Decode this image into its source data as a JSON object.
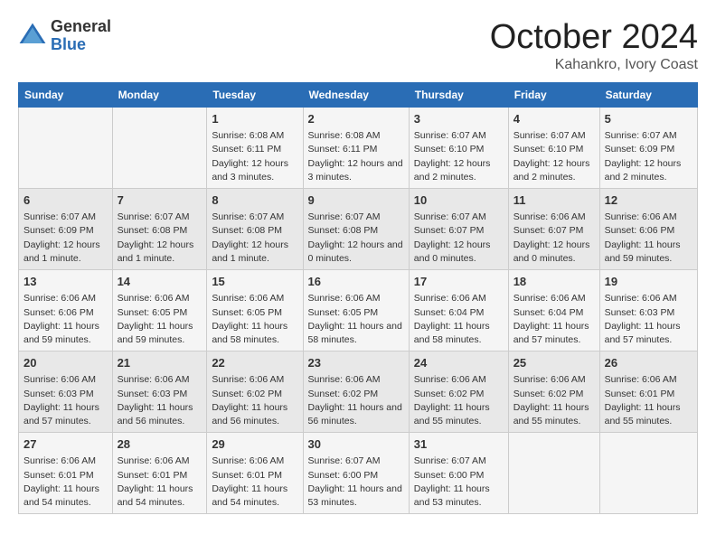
{
  "header": {
    "logo_general": "General",
    "logo_blue": "Blue",
    "month": "October 2024",
    "location": "Kahankro, Ivory Coast"
  },
  "days_of_week": [
    "Sunday",
    "Monday",
    "Tuesday",
    "Wednesday",
    "Thursday",
    "Friday",
    "Saturday"
  ],
  "weeks": [
    [
      {
        "day": "",
        "info": ""
      },
      {
        "day": "",
        "info": ""
      },
      {
        "day": "1",
        "info": "Sunrise: 6:08 AM\nSunset: 6:11 PM\nDaylight: 12 hours and 3 minutes."
      },
      {
        "day": "2",
        "info": "Sunrise: 6:08 AM\nSunset: 6:11 PM\nDaylight: 12 hours and 3 minutes."
      },
      {
        "day": "3",
        "info": "Sunrise: 6:07 AM\nSunset: 6:10 PM\nDaylight: 12 hours and 2 minutes."
      },
      {
        "day": "4",
        "info": "Sunrise: 6:07 AM\nSunset: 6:10 PM\nDaylight: 12 hours and 2 minutes."
      },
      {
        "day": "5",
        "info": "Sunrise: 6:07 AM\nSunset: 6:09 PM\nDaylight: 12 hours and 2 minutes."
      }
    ],
    [
      {
        "day": "6",
        "info": "Sunrise: 6:07 AM\nSunset: 6:09 PM\nDaylight: 12 hours and 1 minute."
      },
      {
        "day": "7",
        "info": "Sunrise: 6:07 AM\nSunset: 6:08 PM\nDaylight: 12 hours and 1 minute."
      },
      {
        "day": "8",
        "info": "Sunrise: 6:07 AM\nSunset: 6:08 PM\nDaylight: 12 hours and 1 minute."
      },
      {
        "day": "9",
        "info": "Sunrise: 6:07 AM\nSunset: 6:08 PM\nDaylight: 12 hours and 0 minutes."
      },
      {
        "day": "10",
        "info": "Sunrise: 6:07 AM\nSunset: 6:07 PM\nDaylight: 12 hours and 0 minutes."
      },
      {
        "day": "11",
        "info": "Sunrise: 6:06 AM\nSunset: 6:07 PM\nDaylight: 12 hours and 0 minutes."
      },
      {
        "day": "12",
        "info": "Sunrise: 6:06 AM\nSunset: 6:06 PM\nDaylight: 11 hours and 59 minutes."
      }
    ],
    [
      {
        "day": "13",
        "info": "Sunrise: 6:06 AM\nSunset: 6:06 PM\nDaylight: 11 hours and 59 minutes."
      },
      {
        "day": "14",
        "info": "Sunrise: 6:06 AM\nSunset: 6:05 PM\nDaylight: 11 hours and 59 minutes."
      },
      {
        "day": "15",
        "info": "Sunrise: 6:06 AM\nSunset: 6:05 PM\nDaylight: 11 hours and 58 minutes."
      },
      {
        "day": "16",
        "info": "Sunrise: 6:06 AM\nSunset: 6:05 PM\nDaylight: 11 hours and 58 minutes."
      },
      {
        "day": "17",
        "info": "Sunrise: 6:06 AM\nSunset: 6:04 PM\nDaylight: 11 hours and 58 minutes."
      },
      {
        "day": "18",
        "info": "Sunrise: 6:06 AM\nSunset: 6:04 PM\nDaylight: 11 hours and 57 minutes."
      },
      {
        "day": "19",
        "info": "Sunrise: 6:06 AM\nSunset: 6:03 PM\nDaylight: 11 hours and 57 minutes."
      }
    ],
    [
      {
        "day": "20",
        "info": "Sunrise: 6:06 AM\nSunset: 6:03 PM\nDaylight: 11 hours and 57 minutes."
      },
      {
        "day": "21",
        "info": "Sunrise: 6:06 AM\nSunset: 6:03 PM\nDaylight: 11 hours and 56 minutes."
      },
      {
        "day": "22",
        "info": "Sunrise: 6:06 AM\nSunset: 6:02 PM\nDaylight: 11 hours and 56 minutes."
      },
      {
        "day": "23",
        "info": "Sunrise: 6:06 AM\nSunset: 6:02 PM\nDaylight: 11 hours and 56 minutes."
      },
      {
        "day": "24",
        "info": "Sunrise: 6:06 AM\nSunset: 6:02 PM\nDaylight: 11 hours and 55 minutes."
      },
      {
        "day": "25",
        "info": "Sunrise: 6:06 AM\nSunset: 6:02 PM\nDaylight: 11 hours and 55 minutes."
      },
      {
        "day": "26",
        "info": "Sunrise: 6:06 AM\nSunset: 6:01 PM\nDaylight: 11 hours and 55 minutes."
      }
    ],
    [
      {
        "day": "27",
        "info": "Sunrise: 6:06 AM\nSunset: 6:01 PM\nDaylight: 11 hours and 54 minutes."
      },
      {
        "day": "28",
        "info": "Sunrise: 6:06 AM\nSunset: 6:01 PM\nDaylight: 11 hours and 54 minutes."
      },
      {
        "day": "29",
        "info": "Sunrise: 6:06 AM\nSunset: 6:01 PM\nDaylight: 11 hours and 54 minutes."
      },
      {
        "day": "30",
        "info": "Sunrise: 6:07 AM\nSunset: 6:00 PM\nDaylight: 11 hours and 53 minutes."
      },
      {
        "day": "31",
        "info": "Sunrise: 6:07 AM\nSunset: 6:00 PM\nDaylight: 11 hours and 53 minutes."
      },
      {
        "day": "",
        "info": ""
      },
      {
        "day": "",
        "info": ""
      }
    ]
  ]
}
